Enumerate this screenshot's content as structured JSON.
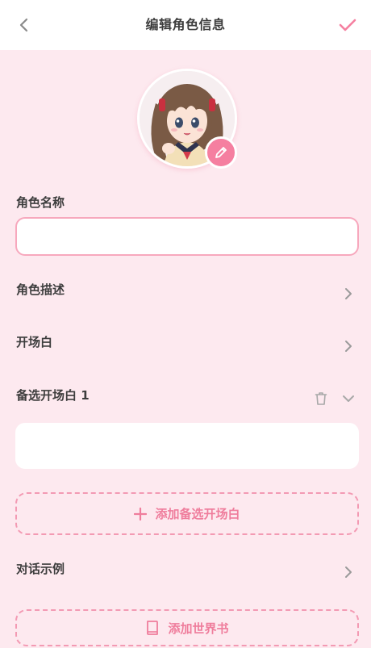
{
  "header": {
    "title": "编辑角色信息",
    "back_icon": "chevron-left-icon",
    "confirm_icon": "check-icon"
  },
  "avatar": {
    "edit_icon": "pencil-icon"
  },
  "form": {
    "name_label": "角色名称",
    "name_value": "",
    "description_label": "角色描述",
    "greeting_label": "开场白",
    "alt_greeting_label": "备选开场白 1",
    "alt_greeting_value": "",
    "add_alt_greeting_label": "添加备选开场白",
    "dialogue_example_label": "对话示例",
    "add_worldbook_label": "添加世界书"
  },
  "colors": {
    "accent": "#f57fa0",
    "background": "#fde9ef",
    "input_border": "#f7a8bd",
    "text": "#3d3d3d"
  }
}
